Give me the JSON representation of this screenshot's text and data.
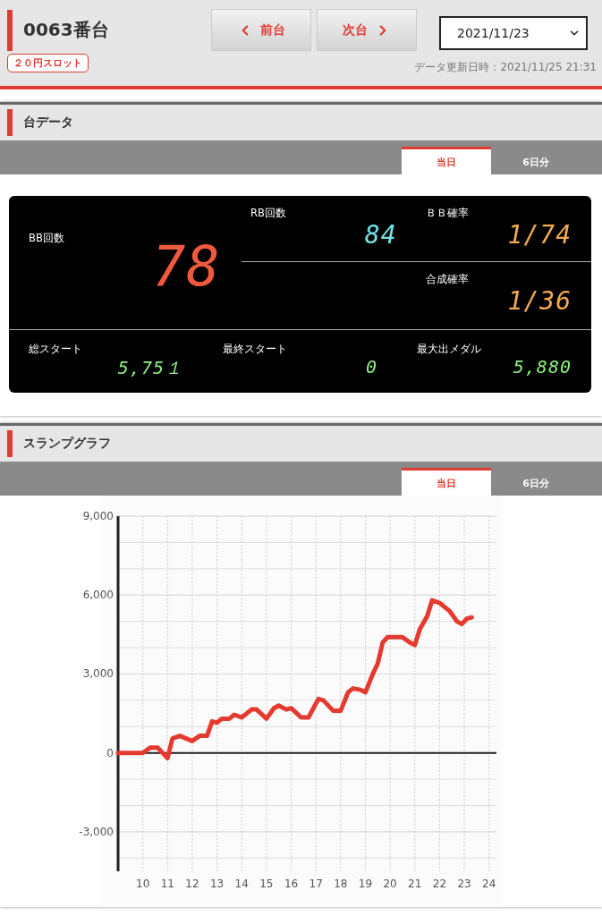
{
  "machine": {
    "title": "0063番台",
    "tag": "２０円スロット",
    "updated": "データ更新日時：2021/11/25 21:31"
  },
  "nav": [
    {
      "label": "前台",
      "kind": "prev"
    },
    {
      "label": "次台",
      "kind": "next"
    }
  ],
  "date_select": {
    "value": "2021/11/23"
  },
  "data_section": {
    "title": "台データ",
    "tabs": [
      {
        "label": "当日",
        "selected": true
      },
      {
        "label": "6日分",
        "selected": false
      }
    ],
    "stats": {
      "main": {
        "label": "BB回数",
        "value": "78",
        "color": "#ef5a3c"
      },
      "right": [
        {
          "label": "RB回数",
          "value": "84",
          "color": "#72e2e6"
        },
        {
          "label": "ＢＢ確率",
          "value": "1/74",
          "color": "#f4a94e"
        },
        {
          "label": "合成確率",
          "value": "1/36",
          "color": "#f4a94e"
        }
      ],
      "bottom": [
        {
          "label": "総スタート",
          "value": "5,75１",
          "color": "#8ef07e"
        },
        {
          "label": "最終スタート",
          "value": "0",
          "color": "#8ef07e"
        },
        {
          "label": "最大出メダル",
          "value": "5,880",
          "color": "#8ef07e"
        }
      ]
    }
  },
  "graph_section": {
    "title": "スランプグラフ",
    "tabs": [
      {
        "label": "当日",
        "selected": true
      },
      {
        "label": "6日分",
        "selected": false
      }
    ],
    "chart_data": {
      "type": "line",
      "x": [
        9,
        10,
        10.3,
        10.6,
        11,
        11.2,
        11.5,
        12,
        12.3,
        12.6,
        12.8,
        13,
        13.2,
        13.5,
        13.7,
        14,
        14.4,
        14.6,
        15,
        15.3,
        15.5,
        15.8,
        16,
        16.4,
        16.7,
        17.1,
        17.3,
        17.7,
        18,
        18.3,
        18.5,
        18.8,
        19,
        19.3,
        19.5,
        19.7,
        19.9,
        20.5,
        20.8,
        21,
        21.2,
        21.5,
        21.7,
        22,
        22.4,
        22.7,
        22.9,
        23.1,
        23.3
      ],
      "series": [
        {
          "color": "#e53a2f",
          "values": [
            0,
            0,
            200,
            200,
            -200,
            550,
            650,
            450,
            650,
            650,
            1200,
            1150,
            1300,
            1300,
            1450,
            1350,
            1650,
            1650,
            1300,
            1700,
            1800,
            1650,
            1700,
            1350,
            1350,
            2050,
            2000,
            1600,
            1600,
            2300,
            2450,
            2400,
            2300,
            3000,
            3400,
            4200,
            4400,
            4400,
            4200,
            4100,
            4700,
            5200,
            5800,
            5700,
            5400,
            5000,
            4900,
            5100,
            5150
          ]
        }
      ],
      "grid": true,
      "xlim": [
        9,
        24.3
      ],
      "ylim": [
        -4500,
        9000
      ],
      "xticks": [
        10,
        11,
        12,
        13,
        14,
        15,
        16,
        17,
        18,
        19,
        20,
        21,
        22,
        23,
        24
      ],
      "yticks": [
        {
          "value": -3000,
          "label": "-3,000"
        },
        {
          "value": 0,
          "label": "0"
        },
        {
          "value": 3000,
          "label": "3,000"
        },
        {
          "value": 6000,
          "label": "6,000"
        },
        {
          "value": 9000,
          "label": "9,000"
        }
      ]
    }
  }
}
